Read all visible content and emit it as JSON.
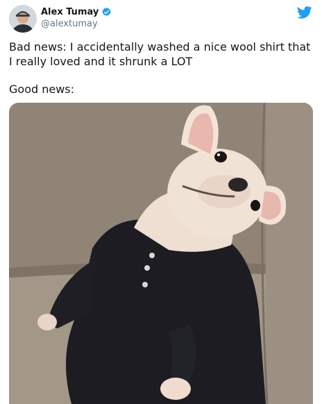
{
  "author": {
    "name": "Alex Tumay",
    "handle": "@alextumay",
    "verified": true,
    "avatar_icon": "avatar-photo"
  },
  "brand": {
    "icon": "twitter-bird-icon",
    "color": "#1da1f2"
  },
  "tweet": {
    "paragraphs": [
      "Bad news: I accidentally washed a nice wool shirt that I really loved and it shrunk a LOT",
      "Good news:"
    ]
  },
  "media": {
    "type": "photo",
    "subject": "french-bulldog-in-shrunken-wool-shirt"
  },
  "colors": {
    "text": "#14171a",
    "secondary_text": "#657786",
    "verified_badge": "#1da1f2",
    "background": "#ffffff"
  }
}
